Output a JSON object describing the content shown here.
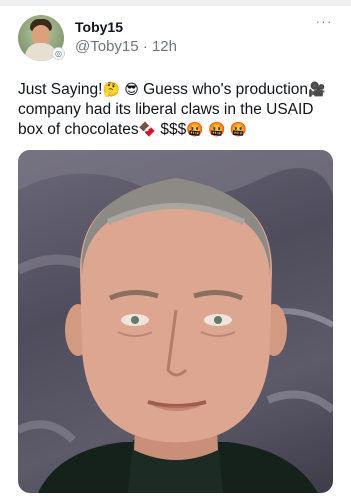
{
  "post": {
    "display_name": "Toby15",
    "handle": "@Toby15",
    "separator": "·",
    "time": "12h",
    "more_label": "···",
    "text_lines": [
      [
        "Just Saying!",
        "🤔",
        "😎",
        "Guess who's production",
        "🎥"
      ],
      [
        "company had its liberal claws in the USAID"
      ],
      [
        "box of chocolates",
        "🍫",
        " $$$",
        "🤬",
        "🤬",
        "🤬"
      ]
    ],
    "media_alt": "photo of a man"
  },
  "icons": {
    "avatar": "avatar-image",
    "badge": "profile-badge-icon",
    "more": "more-options-icon"
  },
  "colors": {
    "text": "#0f1419",
    "secondary": "#6e767d",
    "media_background": "#5a5766"
  }
}
